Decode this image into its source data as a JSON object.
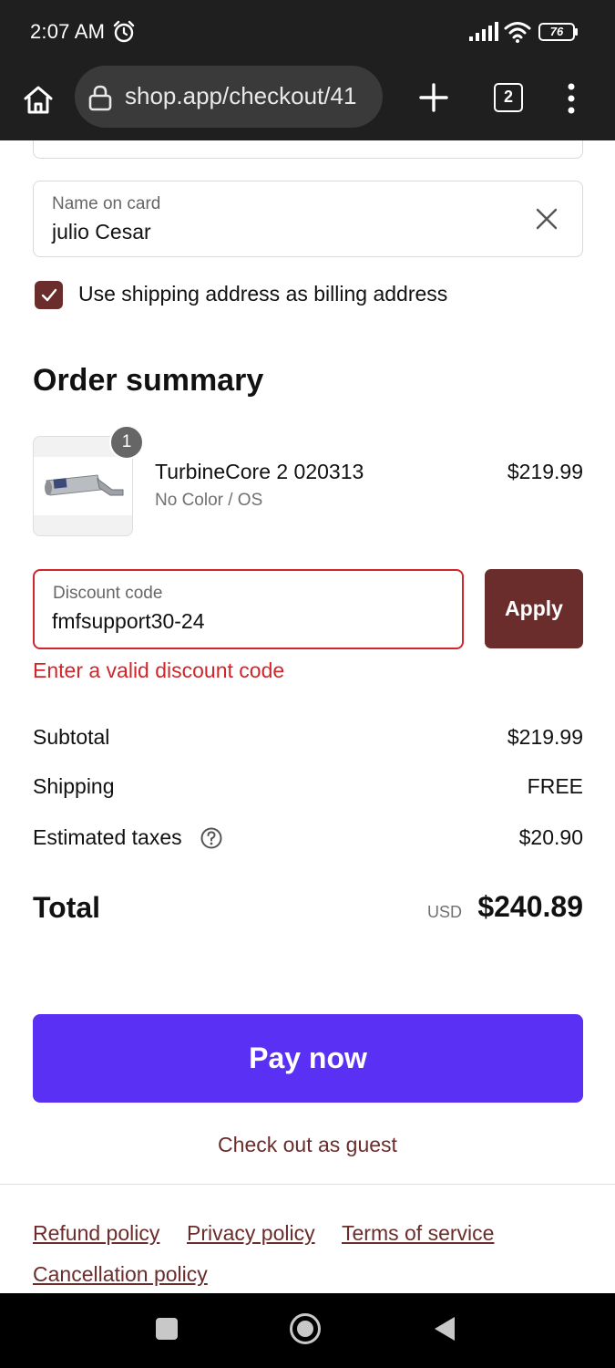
{
  "status_bar": {
    "time": "2:07 AM",
    "battery": "76",
    "icons": [
      "alarm-icon",
      "signal-icon",
      "wifi-icon",
      "battery-icon"
    ]
  },
  "browser": {
    "url": "shop.app/checkout/41",
    "tab_count": "2",
    "icons": [
      "home-icon",
      "lock-icon",
      "plus-icon",
      "more-vert-icon"
    ]
  },
  "payment": {
    "name_on_card": {
      "label": "Name on card",
      "value": "julio Cesar"
    },
    "billing_checkbox": {
      "label": "Use shipping address as billing address",
      "checked": true
    }
  },
  "order_summary": {
    "title": "Order summary",
    "items": [
      {
        "quantity": "1",
        "name": "TurbineCore 2 020313",
        "variant": "No Color / OS",
        "price": "$219.99"
      }
    ],
    "discount": {
      "label": "Discount code",
      "value": "fmfsupport30-24",
      "apply_label": "Apply",
      "error": "Enter a valid discount code"
    },
    "lines": [
      {
        "label": "Subtotal",
        "value": "$219.99"
      },
      {
        "label": "Shipping",
        "value": "FREE"
      },
      {
        "label": "Estimated taxes",
        "value": "$20.90"
      }
    ],
    "total": {
      "label": "Total",
      "currency": "USD",
      "value": "$240.89"
    }
  },
  "actions": {
    "pay_label": "Pay now",
    "guest_label": "Check out as guest"
  },
  "footer": {
    "links": [
      "Refund policy",
      "Privacy policy",
      "Terms of service",
      "Cancellation policy"
    ]
  },
  "colors": {
    "accent": "#6b2c2c",
    "pay_button": "#5a31f4",
    "error": "#d0262b"
  }
}
